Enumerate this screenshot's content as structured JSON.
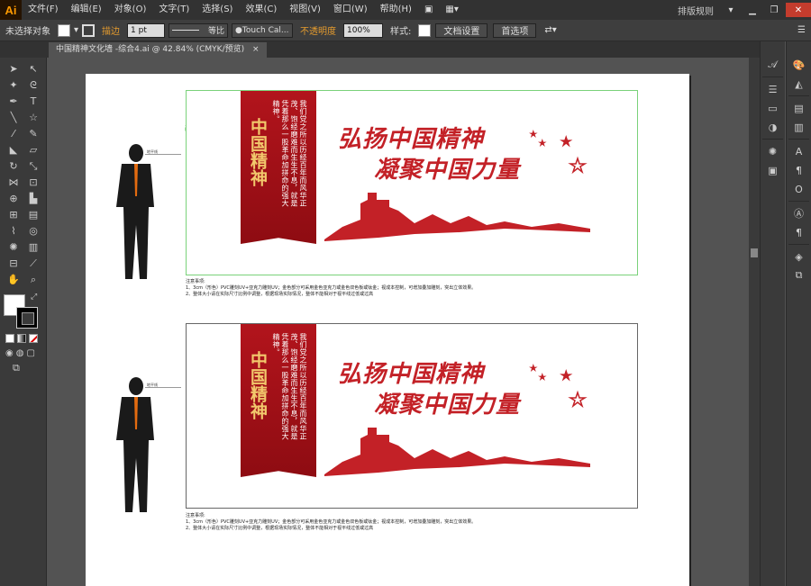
{
  "app": {
    "logo": "Ai",
    "workspace": "排版规则"
  },
  "menu": [
    "文件(F)",
    "编辑(E)",
    "对象(O)",
    "文字(T)",
    "选择(S)",
    "效果(C)",
    "视图(V)",
    "窗口(W)",
    "帮助(H)"
  ],
  "control": {
    "selection": "未选择对象",
    "stroke_label": "描边",
    "stroke_value": "1 pt",
    "brush_label": "等比",
    "font_value": "Touch Cal...",
    "opacity_label": "不透明度",
    "opacity_value": "100%",
    "style_label": "样式:",
    "doc_setup": "文档设置",
    "prefs": "首选项"
  },
  "document": {
    "tab_title": "中国精神文化墙  -综合4.ai @ 42.84% (CMYK/预览)",
    "close": "×"
  },
  "artwork": {
    "panel1": {
      "banner_title": "中国精神",
      "banner_text": "我们党之所以历经百年而风华正茂、饱经磨难而生生不息，就是凭着那么一股革命加拼命的强大精神。",
      "slogan_line1": "弘扬中国精神",
      "slogan_line2": "凝聚中国力量",
      "floor_label": "地平线",
      "green_label": "画框"
    },
    "panel2": {
      "banner_title": "中国精神",
      "banner_text": "我们党之所以历经百年而风华正茂、饱经磨难而生生不息，就是凭着那么一股革命加拼命的强大精神。",
      "slogan_line1": "弘扬中国精神",
      "slogan_line2": "凝聚中国力量",
      "floor_label": "地平线"
    },
    "notes1": [
      "注意事项:",
      "1、3cm（形色）PVC雕刻UV+亚克力雕刻UV；金色部分可采用金色亚克力或金色双色板或钛金；视成本控制，可增加叠加雕刻，突出立体效果。",
      "2、整体大小请在实际尺寸比例中调整，根据现场实际情况，整体不能相对于视平线过低或过高"
    ],
    "notes2": [
      "注意事项:",
      "1、3cm（形色）PVC雕刻UV+亚克力雕刻UV；金色部分可采用金色亚克力或金色双色板或钛金；视成本控制，可增加叠加雕刻，突出立体效果。",
      "2、整体大小请在实际尺寸比例中调整，根据现场实际情况，整体不能相对于视平线过低或过高"
    ]
  },
  "colors": {
    "accent_red": "#c32127",
    "gold": "#f2c86c",
    "ui_dark": "#323232"
  }
}
